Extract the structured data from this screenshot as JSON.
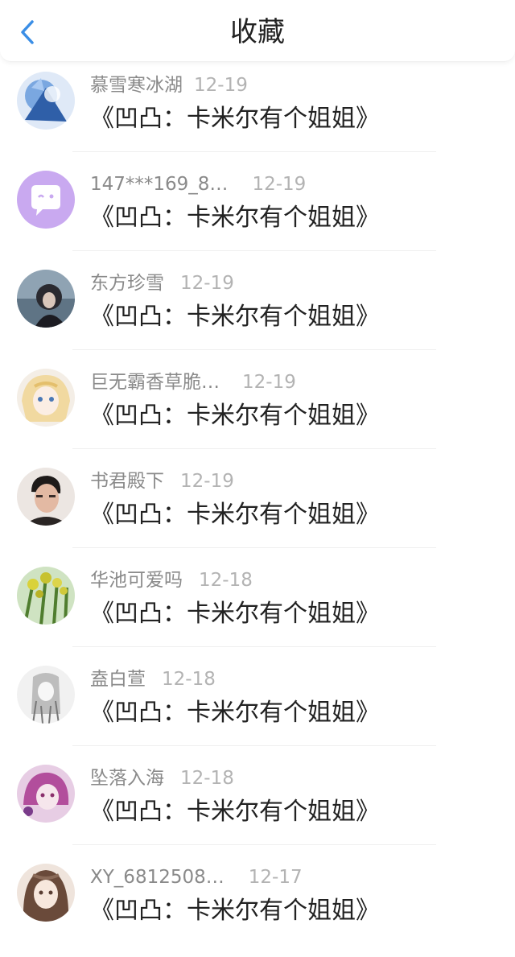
{
  "header": {
    "title": "收藏",
    "back_icon": "chevron-left-icon",
    "back_color": "#3a8ee6"
  },
  "favorites": [
    {
      "user": "慕雪寒冰湖",
      "date": "12-19",
      "book": "《凹凸：卡米尔有个姐姐》",
      "avatar": "blue-anime-character-avatar"
    },
    {
      "user": "147***169_8…",
      "date": "12-19",
      "book": "《凹凸：卡米尔有个姐姐》",
      "avatar": "purple-chat-bubble-avatar"
    },
    {
      "user": "东方珍雪",
      "date": "12-19",
      "book": "《凹凸：卡米尔有个姐姐》",
      "avatar": "dark-anime-avatar"
    },
    {
      "user": "巨无霸香草脆…",
      "date": "12-19",
      "book": "《凹凸：卡米尔有个姐姐》",
      "avatar": "blonde-anime-girl-avatar"
    },
    {
      "user": "书君殿下",
      "date": "12-19",
      "book": "《凹凸：卡米尔有个姐姐》",
      "avatar": "man-photo-avatar"
    },
    {
      "user": "华池可爱吗",
      "date": "12-18",
      "book": "《凹凸：卡米尔有个姐姐》",
      "avatar": "green-plant-avatar"
    },
    {
      "user": "盍白萱",
      "date": "12-18",
      "book": "《凹凸：卡米尔有个姐姐》",
      "avatar": "sketch-anime-avatar"
    },
    {
      "user": "坠落入海",
      "date": "12-18",
      "book": "《凹凸：卡米尔有个姐姐》",
      "avatar": "pink-anime-avatar"
    },
    {
      "user": "XY_6812508…",
      "date": "12-17",
      "book": "《凹凸：卡米尔有个姐姐》",
      "avatar": "brown-hair-anime-avatar"
    }
  ]
}
